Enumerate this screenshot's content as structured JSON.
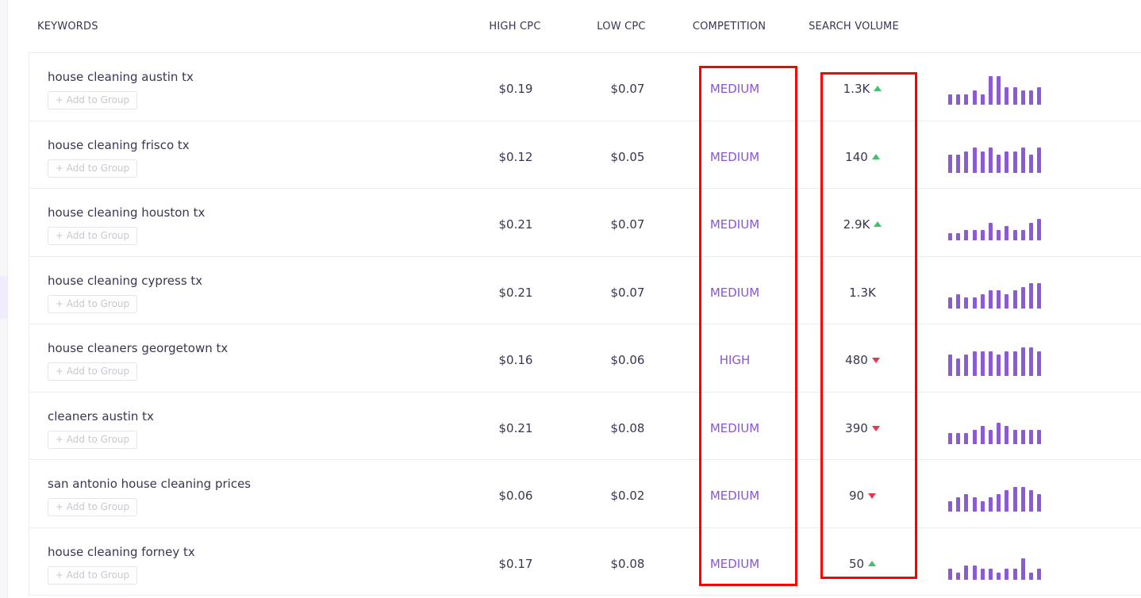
{
  "columns": {
    "keywords": "KEYWORDS",
    "high_cpc": "HIGH CPC",
    "low_cpc": "LOW CPC",
    "competition": "COMPETITION",
    "search_volume": "SEARCH VOLUME"
  },
  "add_to_group_label": "+ Add to Group",
  "colors": {
    "accent": "#8a55d6",
    "trend_up": "#3fc26b",
    "trend_down": "#e23a4a",
    "highlight": "#ff0000"
  },
  "rows": [
    {
      "keyword": "house cleaning austin tx",
      "high_cpc": "$0.19",
      "low_cpc": "$0.07",
      "competition": "MEDIUM",
      "volume": "1.3K",
      "trend": "up",
      "spark": [
        3,
        3,
        3,
        4,
        3,
        8,
        8,
        5,
        5,
        4,
        4,
        5
      ]
    },
    {
      "keyword": "house cleaning frisco tx",
      "high_cpc": "$0.12",
      "low_cpc": "$0.05",
      "competition": "MEDIUM",
      "volume": "140",
      "trend": "up",
      "spark": [
        5,
        5,
        6,
        7,
        6,
        7,
        5,
        6,
        6,
        7,
        5,
        7
      ]
    },
    {
      "keyword": "house cleaning houston tx",
      "high_cpc": "$0.21",
      "low_cpc": "$0.07",
      "competition": "MEDIUM",
      "volume": "2.9K",
      "trend": "up",
      "spark": [
        2,
        2,
        3,
        3,
        3,
        5,
        3,
        4,
        3,
        3,
        5,
        6
      ]
    },
    {
      "keyword": "house cleaning cypress tx",
      "high_cpc": "$0.21",
      "low_cpc": "$0.07",
      "competition": "MEDIUM",
      "volume": "1.3K",
      "trend": "",
      "spark": [
        3,
        4,
        3,
        3,
        4,
        5,
        5,
        4,
        5,
        6,
        7,
        7
      ]
    },
    {
      "keyword": "house cleaners georgetown tx",
      "high_cpc": "$0.16",
      "low_cpc": "$0.06",
      "competition": "HIGH",
      "volume": "480",
      "trend": "down",
      "spark": [
        6,
        5,
        6,
        7,
        7,
        7,
        6,
        7,
        7,
        8,
        8,
        7
      ]
    },
    {
      "keyword": "cleaners austin tx",
      "high_cpc": "$0.21",
      "low_cpc": "$0.08",
      "competition": "MEDIUM",
      "volume": "390",
      "trend": "down",
      "spark": [
        3,
        3,
        3,
        4,
        5,
        4,
        6,
        5,
        4,
        4,
        4,
        4
      ]
    },
    {
      "keyword": "san antonio house cleaning prices",
      "high_cpc": "$0.06",
      "low_cpc": "$0.02",
      "competition": "MEDIUM",
      "volume": "90",
      "trend": "down",
      "spark": [
        3,
        4,
        5,
        4,
        3,
        4,
        5,
        6,
        7,
        7,
        6,
        5
      ]
    },
    {
      "keyword": "house cleaning forney tx",
      "high_cpc": "$0.17",
      "low_cpc": "$0.08",
      "competition": "MEDIUM",
      "volume": "50",
      "trend": "up",
      "spark": [
        3,
        2,
        4,
        4,
        3,
        3,
        2,
        3,
        3,
        6,
        2,
        3
      ]
    }
  ]
}
